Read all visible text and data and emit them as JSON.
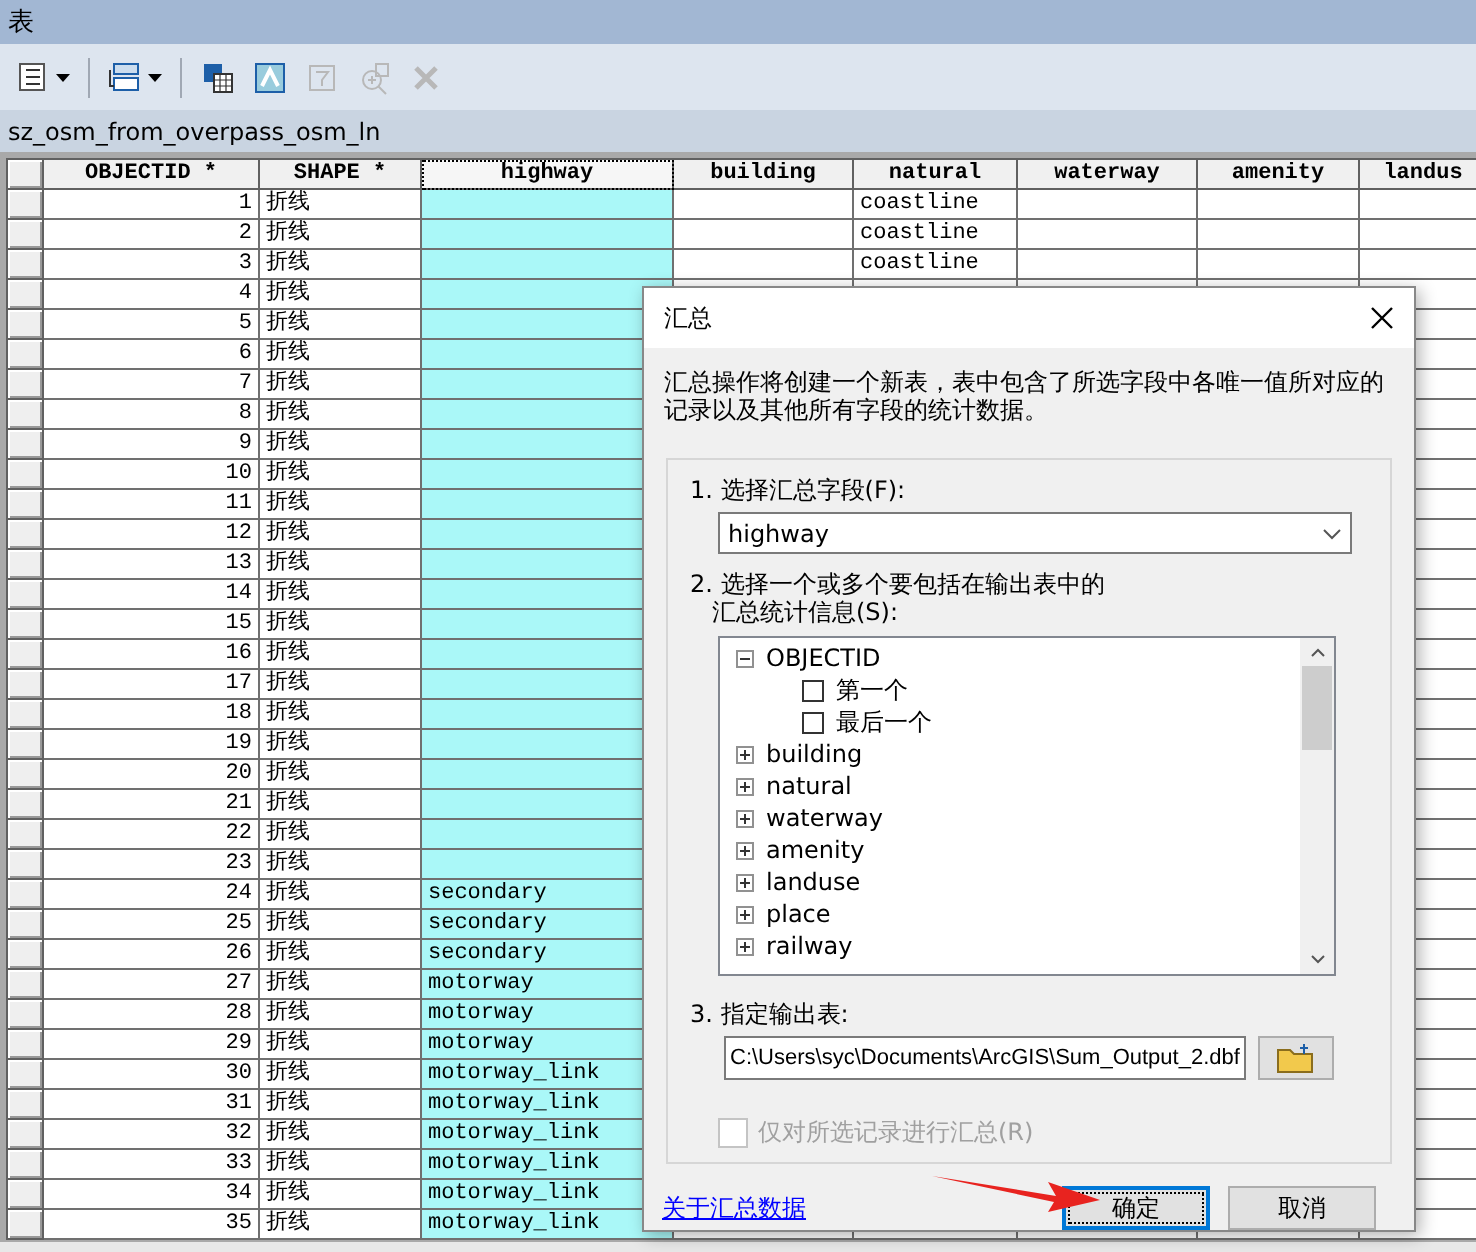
{
  "window": {
    "title": "表"
  },
  "toolbar": [
    {
      "kind": "options",
      "dropdown": true,
      "disabled": false
    },
    {
      "kind": "related",
      "dropdown": true,
      "disabled": false
    },
    {
      "kind": "select-all",
      "dropdown": false,
      "disabled": false
    },
    {
      "kind": "switch",
      "dropdown": false,
      "disabled": false
    },
    {
      "kind": "clear",
      "dropdown": false,
      "disabled": true
    },
    {
      "kind": "zoom",
      "dropdown": false,
      "disabled": true
    },
    {
      "kind": "delete",
      "dropdown": false,
      "disabled": true
    }
  ],
  "table": {
    "name": "sz_osm_from_overpass_osm_ln",
    "columns": [
      {
        "label": "OBJECTID *",
        "selected": false
      },
      {
        "label": "SHAPE *",
        "selected": false
      },
      {
        "label": "highway",
        "selected": true
      },
      {
        "label": "building",
        "selected": false
      },
      {
        "label": "natural",
        "selected": false
      },
      {
        "label": "waterway",
        "selected": false
      },
      {
        "label": "amenity",
        "selected": false
      },
      {
        "label": "landus",
        "selected": false
      }
    ],
    "rows": [
      {
        "objectid": "1",
        "shape": "折线",
        "natural": "coastline"
      },
      {
        "objectid": "2",
        "shape": "折线",
        "natural": "coastline"
      },
      {
        "objectid": "3",
        "shape": "折线",
        "natural": "coastline"
      },
      {
        "objectid": "4",
        "shape": "折线"
      },
      {
        "objectid": "5",
        "shape": "折线"
      },
      {
        "objectid": "6",
        "shape": "折线"
      },
      {
        "objectid": "7",
        "shape": "折线"
      },
      {
        "objectid": "8",
        "shape": "折线"
      },
      {
        "objectid": "9",
        "shape": "折线"
      },
      {
        "objectid": "10",
        "shape": "折线"
      },
      {
        "objectid": "11",
        "shape": "折线"
      },
      {
        "objectid": "12",
        "shape": "折线"
      },
      {
        "objectid": "13",
        "shape": "折线"
      },
      {
        "objectid": "14",
        "shape": "折线"
      },
      {
        "objectid": "15",
        "shape": "折线"
      },
      {
        "objectid": "16",
        "shape": "折线"
      },
      {
        "objectid": "17",
        "shape": "折线"
      },
      {
        "objectid": "18",
        "shape": "折线"
      },
      {
        "objectid": "19",
        "shape": "折线"
      },
      {
        "objectid": "20",
        "shape": "折线"
      },
      {
        "objectid": "21",
        "shape": "折线"
      },
      {
        "objectid": "22",
        "shape": "折线"
      },
      {
        "objectid": "23",
        "shape": "折线"
      },
      {
        "objectid": "24",
        "shape": "折线",
        "highway": "secondary"
      },
      {
        "objectid": "25",
        "shape": "折线",
        "highway": "secondary"
      },
      {
        "objectid": "26",
        "shape": "折线",
        "highway": "secondary"
      },
      {
        "objectid": "27",
        "shape": "折线",
        "highway": "motorway"
      },
      {
        "objectid": "28",
        "shape": "折线",
        "highway": "motorway"
      },
      {
        "objectid": "29",
        "shape": "折线",
        "highway": "motorway"
      },
      {
        "objectid": "30",
        "shape": "折线",
        "highway": "motorway_link"
      },
      {
        "objectid": "31",
        "shape": "折线",
        "highway": "motorway_link"
      },
      {
        "objectid": "32",
        "shape": "折线",
        "highway": "motorway_link"
      },
      {
        "objectid": "33",
        "shape": "折线",
        "highway": "motorway_link"
      },
      {
        "objectid": "34",
        "shape": "折线",
        "highway": "motorway_link"
      },
      {
        "objectid": "35",
        "shape": "折线",
        "highway": "motorway_link"
      }
    ]
  },
  "dialog": {
    "title": "汇总",
    "description": "汇总操作将创建一个新表，表中包含了所选字段中各唯一值所对应的记录以及其他所有字段的统计数据。",
    "field_label": "1. 选择汇总字段(F):",
    "field_value": "highway",
    "stats_label": [
      "2. 选择一个或多个要包括在输出表中的",
      "汇总统计信息(S):"
    ],
    "stats_tree": [
      {
        "label": "OBJECTID",
        "expanded": true,
        "children": [
          {
            "label": "第一个",
            "checked": false
          },
          {
            "label": "最后一个",
            "checked": false
          }
        ]
      },
      {
        "label": "building",
        "expanded": false
      },
      {
        "label": "natural",
        "expanded": false
      },
      {
        "label": "waterway",
        "expanded": false
      },
      {
        "label": "amenity",
        "expanded": false
      },
      {
        "label": "landuse",
        "expanded": false
      },
      {
        "label": "place",
        "expanded": false
      },
      {
        "label": "railway",
        "expanded": false
      }
    ],
    "output_label": "3. 指定输出表:",
    "output_value": "C:\\Users\\syc\\Documents\\ArcGIS\\Sum_Output_2.dbf",
    "selected_only": {
      "label": "仅对所选记录进行汇总(R)",
      "checked": false,
      "disabled": true
    },
    "help_link": "关于汇总数据",
    "buttons": [
      {
        "label": "确定",
        "default": true
      },
      {
        "label": "取消",
        "default": false
      }
    ]
  }
}
